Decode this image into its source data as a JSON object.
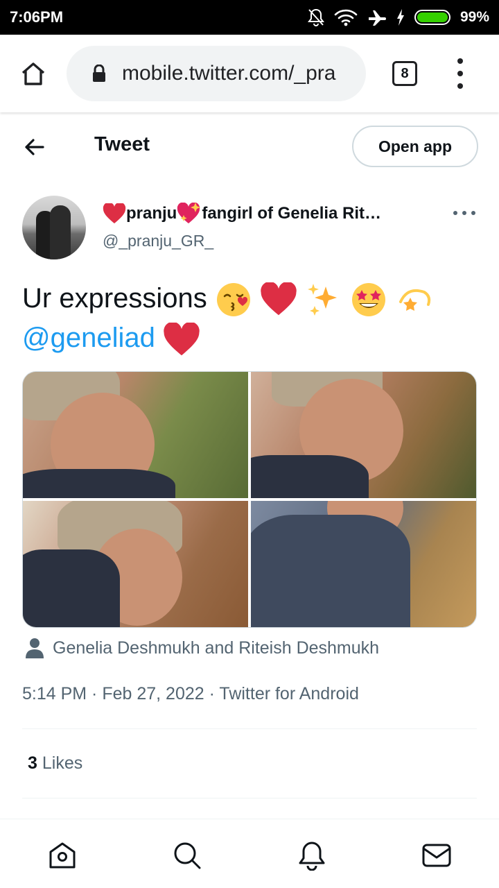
{
  "status_bar": {
    "time": "7:06PM",
    "battery_pct": "99%"
  },
  "browser": {
    "url": "mobile.twitter.com/_pra",
    "tab_count": "8"
  },
  "header": {
    "title": "Tweet",
    "open_app_label": "Open app"
  },
  "author": {
    "name": "pranju",
    "name_suffix": "fangirl of Genelia Rit…",
    "handle": "@_pranju_GR_"
  },
  "tweet": {
    "text": "Ur expressions",
    "mention": "@geneliad",
    "photo_credit": "Genelia Deshmukh and Riteish Deshmukh",
    "meta": "5:14 PM · Feb 27, 2022 · Twitter for Android"
  },
  "stats": {
    "likes_count": "3",
    "likes_label": "Likes"
  },
  "icons": [
    "home-icon",
    "lock-icon",
    "back-arrow-icon",
    "more-icon",
    "person-icon",
    "search-icon",
    "bell-icon",
    "mail-icon"
  ],
  "colors": {
    "link": "#1d9bf0",
    "text": "#0f1419",
    "secondary": "#536471",
    "heart": "#e0245e"
  }
}
